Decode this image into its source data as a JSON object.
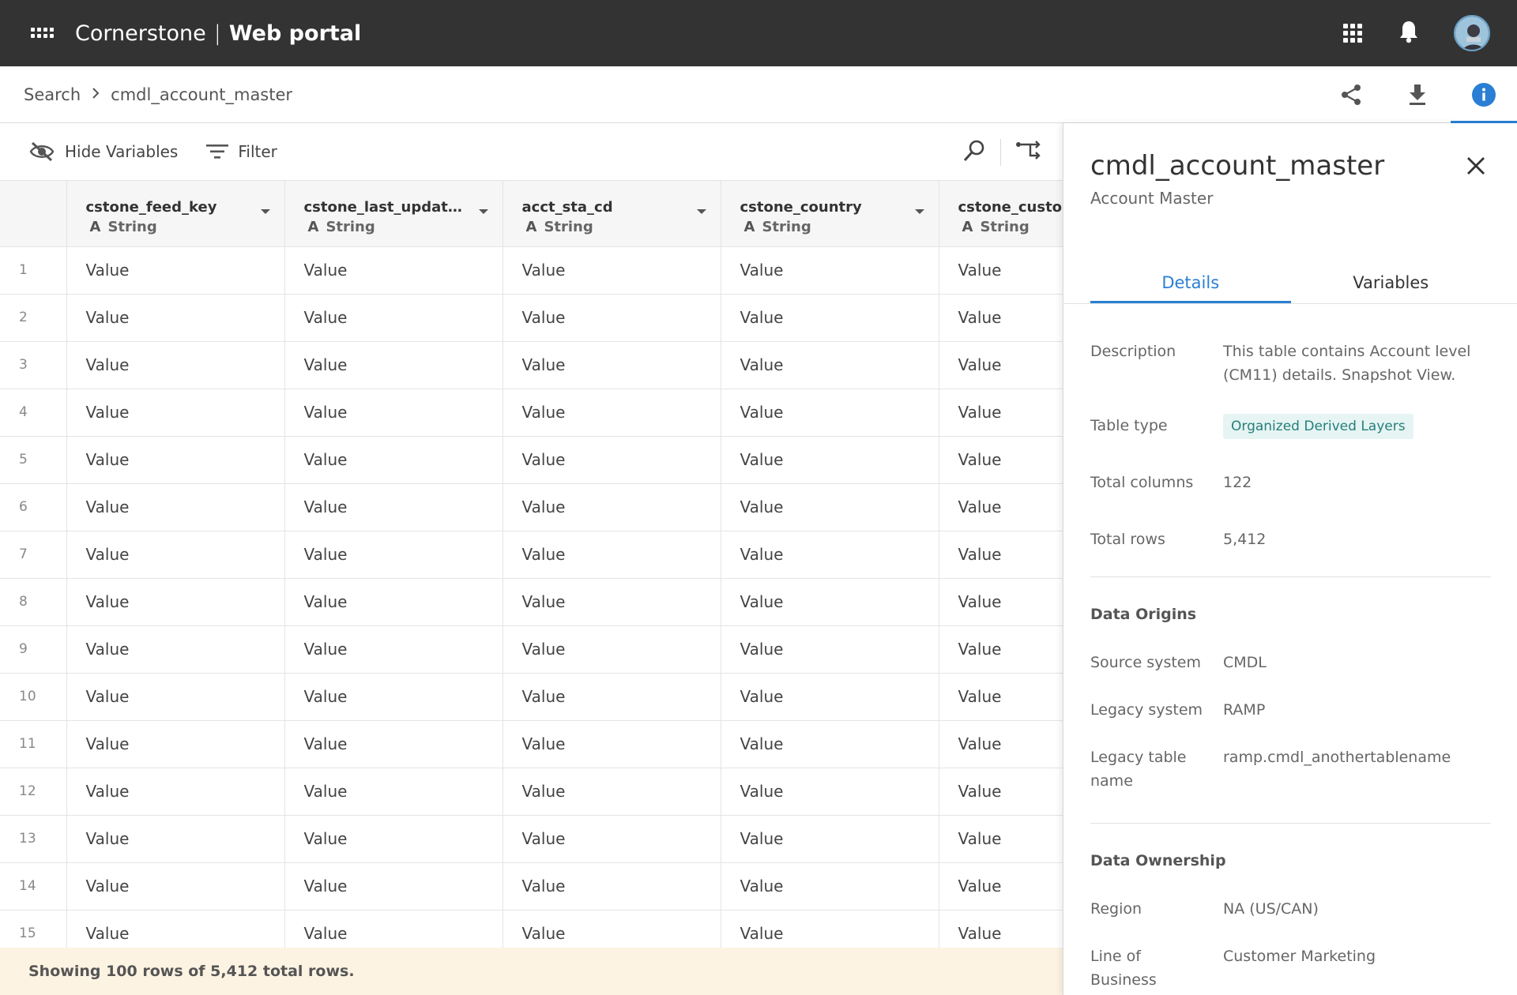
{
  "app": {
    "brand_name": "Cornerstone",
    "brand_separator": "|",
    "brand_product": "Web portal"
  },
  "breadcrumb": {
    "root": "Search",
    "current": "cmdl_account_master"
  },
  "toolbar": {
    "hide_variables_label": "Hide Variables",
    "filter_label": "Filter"
  },
  "table": {
    "columns": [
      {
        "name": "cstone_feed_key",
        "type": "String"
      },
      {
        "name": "cstone_last_update...",
        "type": "String"
      },
      {
        "name": "acct_sta_cd",
        "type": "String"
      },
      {
        "name": "cstone_country",
        "type": "String"
      },
      {
        "name": "cstone_custom",
        "type": "String"
      }
    ],
    "type_glyph": "A",
    "rows": [
      {
        "num": "1",
        "cells": [
          "Value",
          "Value",
          "Value",
          "Value",
          "Value"
        ]
      },
      {
        "num": "2",
        "cells": [
          "Value",
          "Value",
          "Value",
          "Value",
          "Value"
        ]
      },
      {
        "num": "3",
        "cells": [
          "Value",
          "Value",
          "Value",
          "Value",
          "Value"
        ]
      },
      {
        "num": "4",
        "cells": [
          "Value",
          "Value",
          "Value",
          "Value",
          "Value"
        ]
      },
      {
        "num": "5",
        "cells": [
          "Value",
          "Value",
          "Value",
          "Value",
          "Value"
        ]
      },
      {
        "num": "6",
        "cells": [
          "Value",
          "Value",
          "Value",
          "Value",
          "Value"
        ]
      },
      {
        "num": "7",
        "cells": [
          "Value",
          "Value",
          "Value",
          "Value",
          "Value"
        ]
      },
      {
        "num": "8",
        "cells": [
          "Value",
          "Value",
          "Value",
          "Value",
          "Value"
        ]
      },
      {
        "num": "9",
        "cells": [
          "Value",
          "Value",
          "Value",
          "Value",
          "Value"
        ]
      },
      {
        "num": "10",
        "cells": [
          "Value",
          "Value",
          "Value",
          "Value",
          "Value"
        ]
      },
      {
        "num": "11",
        "cells": [
          "Value",
          "Value",
          "Value",
          "Value",
          "Value"
        ]
      },
      {
        "num": "12",
        "cells": [
          "Value",
          "Value",
          "Value",
          "Value",
          "Value"
        ]
      },
      {
        "num": "13",
        "cells": [
          "Value",
          "Value",
          "Value",
          "Value",
          "Value"
        ]
      },
      {
        "num": "14",
        "cells": [
          "Value",
          "Value",
          "Value",
          "Value",
          "Value"
        ]
      },
      {
        "num": "15",
        "cells": [
          "Value",
          "Value",
          "Value",
          "Value",
          "Value"
        ]
      }
    ],
    "footer_text": "Showing 100 rows of 5,412 total rows."
  },
  "panel": {
    "title": "cmdl_account_master",
    "subtitle": "Account Master",
    "tabs": [
      {
        "label": "Details",
        "active": true
      },
      {
        "label": "Variables",
        "active": false
      }
    ],
    "details": {
      "description_label": "Description",
      "description_value": "This table contains Account level (CM11) details. Snapshot View.",
      "table_type_label": "Table type",
      "table_type_value": "Organized Derived Layers",
      "total_columns_label": "Total columns",
      "total_columns_value": "122",
      "total_rows_label": "Total rows",
      "total_rows_value": "5,412"
    },
    "data_origins": {
      "heading": "Data Origins",
      "source_system_label": "Source system",
      "source_system_value": "CMDL",
      "legacy_system_label": "Legacy system",
      "legacy_system_value": "RAMP",
      "legacy_table_label": "Legacy table name",
      "legacy_table_value": "ramp.cmdl_anothertablename"
    },
    "data_ownership": {
      "heading": "Data Ownership",
      "region_label": "Region",
      "region_value": "NA (US/CAN)",
      "lob_label": "Line of Business",
      "lob_value": "Customer Marketing"
    }
  },
  "colors": {
    "topbar_bg": "#333333",
    "accent_blue": "#2a7fd4",
    "badge_bg": "#e6f4f3",
    "badge_text": "#247f7a",
    "footer_bg": "#fdf3e2"
  },
  "icons": {
    "topbar_left": "apps-launcher-icon",
    "topbar_right": [
      "grid-apps-icon",
      "bell-icon",
      "avatar"
    ],
    "breadcrumb_actions": [
      "share-icon",
      "download-icon",
      "info-icon"
    ],
    "toolbar": [
      "eye-off-icon",
      "filter-icon",
      "search-icon",
      "pivot-icon"
    ],
    "panel": [
      "close-icon"
    ]
  }
}
